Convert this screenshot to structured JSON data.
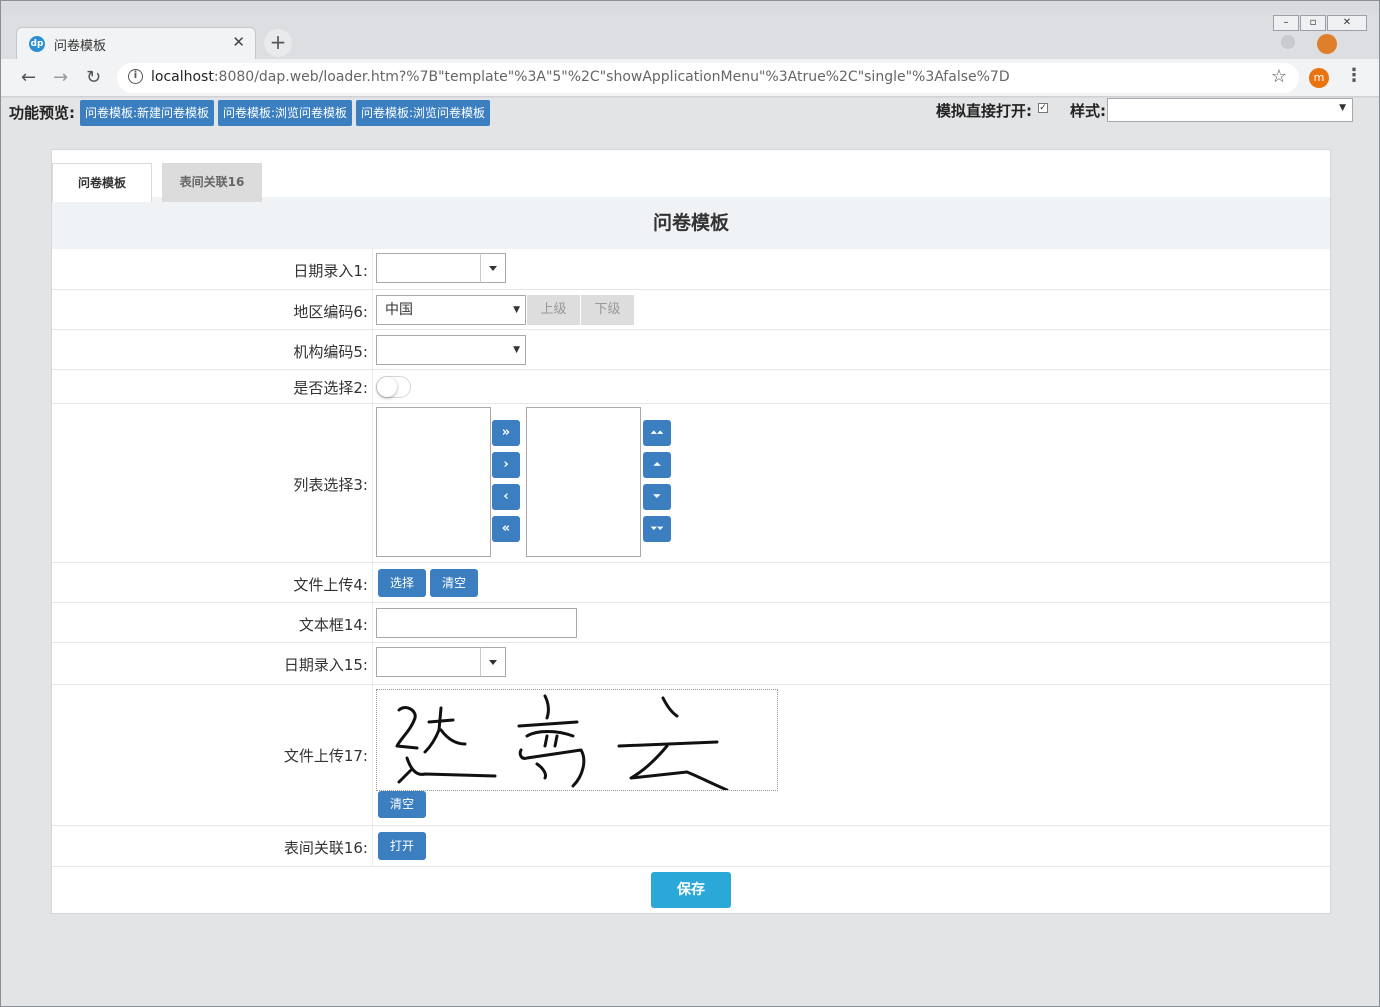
{
  "browser": {
    "tab_title": "问卷模板",
    "tab_icon": "app-logo-icon",
    "url_host": "localhost",
    "url_rest": ":8080/dap.web/loader.htm?%7B\"template\"%3A\"5\"%2C\"showApplicationMenu\"%3Atrue%2C\"single\"%3Afalse%7D",
    "avatar_letter": "m",
    "close_glyph": "✕",
    "newtab_glyph": "+",
    "back_glyph": "←",
    "forward_glyph": "→",
    "reload_glyph": "↻",
    "star_glyph": "☆",
    "menu_glyph": "⋮",
    "info_glyph": "i",
    "minimize_glyph": "–",
    "maximize_glyph": "▫",
    "winclose_glyph": "✕"
  },
  "toolbar": {
    "preview_label": "功能预览:",
    "preview_buttons": [
      "问卷模板:新建问卷模板",
      "问卷模板:浏览问卷模板",
      "问卷模板:浏览问卷模板"
    ],
    "simulate_label": "模拟直接打开:",
    "simulate_checked": true,
    "check_glyph": "✓",
    "style_label": "样式:",
    "style_value": "",
    "select_arrow": "▼"
  },
  "tabs": [
    "问卷模板",
    "表间关联16"
  ],
  "form": {
    "title": "问卷模板",
    "date1_label": "日期录入1:",
    "date1_value": "",
    "region_label": "地区编码6:",
    "region_value": "中国",
    "region_up": "上级",
    "region_down": "下级",
    "org_label": "机构编码5:",
    "org_value": "",
    "yesno_label": "是否选择2:",
    "yesno_on": false,
    "list_label": "列表选择3:",
    "list_move_buttons": [
      "»",
      "›",
      "‹",
      "«"
    ],
    "list_order_buttons": [
      "⏶⏶",
      "⏶",
      "⏷",
      "⏷⏷"
    ],
    "file4_label": "文件上传4:",
    "file4_select": "选择",
    "file4_clear": "清空",
    "text14_label": "文本框14:",
    "text14_value": "",
    "date15_label": "日期录入15:",
    "date15_value": "",
    "file17_label": "文件上传17:",
    "file17_clear": "清空",
    "relation_label": "表间关联16:",
    "relation_open": "打开",
    "save": "保存"
  },
  "colors": {
    "primary_button": "#3b7fc1",
    "save_button": "#2aa8d8",
    "form_header_bg": "#f0f3f6",
    "disabled_button_bg": "#dddddd"
  }
}
